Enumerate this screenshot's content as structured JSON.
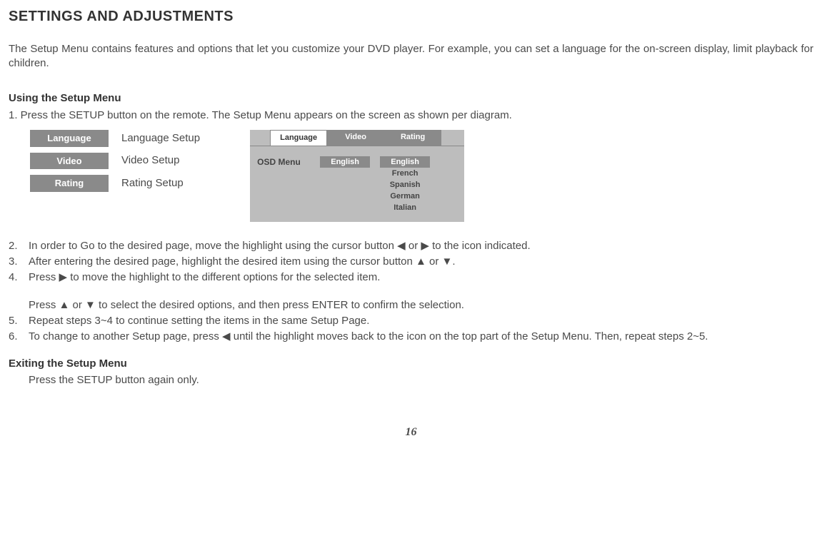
{
  "title": "SETTINGS AND ADJUSTMENTS",
  "intro": "The Setup Menu contains features and options that let you customize your DVD player. For example, you can set a language for the on-screen display, limit playback for children.",
  "using_head": "Using the Setup Menu",
  "step1": "1.  Press the SETUP button on the remote. The Setup Menu appears on the screen as shown per diagram.",
  "legend": [
    {
      "tab": "Language",
      "desc": "Language Setup"
    },
    {
      "tab": "Video",
      "desc": "Video Setup"
    },
    {
      "tab": "Rating",
      "desc": "Rating Setup"
    }
  ],
  "osd": {
    "tabs": [
      "Language",
      "Video",
      "Rating"
    ],
    "active_tab": 0,
    "row_label": "OSD Menu",
    "selected": "English",
    "options": [
      "English",
      "French",
      "Spanish",
      "German",
      "Italian"
    ],
    "option_selected": 0
  },
  "steps": {
    "s2": {
      "n": "2.",
      "t": "In order to Go to the  desired page, move the highlight using the cursor button ◀ or ▶ to the icon indicated."
    },
    "s3": {
      "n": "3.",
      "t": "After entering the desired page, highlight the desired item using the cursor button ▲ or ▼."
    },
    "s4": {
      "n": "4.",
      "t": "Press ▶ to move the highlight to the different options for the selected item."
    },
    "s4b": "Press ▲ or ▼ to select the desired options, and then press ENTER to confirm the selection.",
    "s5": {
      "n": "5.",
      "t": "Repeat steps 3~4 to continue setting the items in the same Setup Page."
    },
    "s6": {
      "n": "6.",
      "t": "To change to another Setup page, press ◀ until the highlight moves back to the icon on the top part of the Setup Menu. Then, repeat steps 2~5."
    }
  },
  "exit_head": "Exiting the Setup Menu",
  "exit_body": "Press the SETUP button again only.",
  "page_number": "16"
}
